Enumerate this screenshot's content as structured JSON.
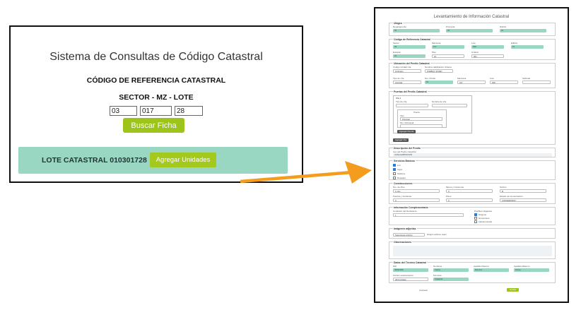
{
  "left": {
    "app_title": "Sistema de Consultas de Código Catastral",
    "ref_title": "CÓDIGO DE REFERENCIA CATASTRAL",
    "sector_label": "SECTOR - MZ - LOTE",
    "sector_value": "03",
    "mz_value": "017",
    "lote_value": "28",
    "buscar_label": "Buscar Ficha",
    "lote_text": "LOTE CATASTRAL 010301728",
    "agregar_label": "Agregar Unidades"
  },
  "right": {
    "title": "Levantamiento de Información Catastral",
    "sec_ubigeo": "Ubigeo",
    "ubigeo_labels": [
      "Departamento",
      "Provincia",
      "Distrito"
    ],
    "ubigeo_values": [
      "01",
      "01",
      "01"
    ],
    "sec_codigo": "Código de Referencia Catastral",
    "codigo_labels_1": [
      "Sector",
      "Manzana",
      "Lote",
      "Edifica"
    ],
    "codigo_values_1": [
      "03",
      "017",
      "028",
      "01"
    ],
    "codigo_labels_2": [
      "Entrada",
      "Piso",
      "Unidad"
    ],
    "codigo_values_2": [
      "01",
      "01",
      "001"
    ],
    "sec_ubicacion": "Ubicación del Predio Catastral",
    "ubic_labels_1": [
      "Código Unidad Cat.",
      "Nombre Habilitación Urbana"
    ],
    "ubic_values_1": [
      "Ordinario",
      "PUEBLO JOVEN"
    ],
    "ubic_labels_2": [
      "Tipo de Vía",
      "Nro. Predio",
      "Manzana",
      "Lote",
      "Subtotal"
    ],
    "ubic_values_2": [
      "Avenida",
      "01",
      "017",
      "028",
      ""
    ],
    "sec_puertas": "Puertas del Predio Catastral",
    "puertas_sub1": "Vía 1",
    "puertas_labels": [
      "Tipo de Vía",
      "Nombre de Vía"
    ],
    "puertas_sub2": "Puerta",
    "puertas_tipo_label": "Tipo",
    "puertas_tipo_value": "Principal",
    "puertas_nro_label": "Nro. Municipal",
    "btn_agregar_puerta": "Agregar Puerta",
    "btn_agregar_via": "Agregar Vía",
    "sec_descripcion": "Descripción del Predio",
    "desc_label": "Uso del Predio Catastral",
    "desc_value": "CASA HABITACION",
    "sec_servicios": "Servicios Básicos",
    "servicios": [
      "Luz",
      "Agua",
      "Teléfono",
      "Desagüe"
    ],
    "sec_construcciones": "Construcciones",
    "constr_labels_1": [
      "Nro. de Piso",
      "Muros y Columnas",
      "Techos"
    ],
    "constr_values_1": [
      "1 piso",
      "C",
      "B"
    ],
    "constr_labels_2": [
      "Puertas y Ventanas",
      "Pisos",
      "Estado de Conservación"
    ],
    "constr_values_2": [
      "C",
      "C",
      "CONSERVADO"
    ],
    "sec_info": "Información Complementaria",
    "info_label": "Condición del Declarante",
    "info_value": "1",
    "info_opts_label": "Posibles Litigantes",
    "info_opts": [
      "Ninguno",
      "Numerosos",
      "Indeterminado"
    ],
    "sec_imagenes": "Imágenes adjuntas",
    "img_btn": "Seleccionar archivo",
    "img_text": "Ningún archivo selec.",
    "sec_observaciones": "Observaciones",
    "sec_tecnico": "Datos del Técnico Catastral",
    "tec_labels": [
      "DNI",
      "Nombres",
      "Apellido Paterno",
      "Apellido Materno"
    ],
    "tec_values": [
      "45632189",
      "Carlos",
      "Ramirez",
      "Flores"
    ],
    "tec_labels_2": [
      "Fecha Levantamiento",
      "Firmante"
    ],
    "tec_values_2": [
      "dd/mm/aaaa",
      "Catastral"
    ],
    "cancel_label": "Cancelar",
    "save_label": "Grabar"
  },
  "colors": {
    "accent": "#9dc41b",
    "teal": "#9ad7c3",
    "arrow": "#f39c1e"
  }
}
